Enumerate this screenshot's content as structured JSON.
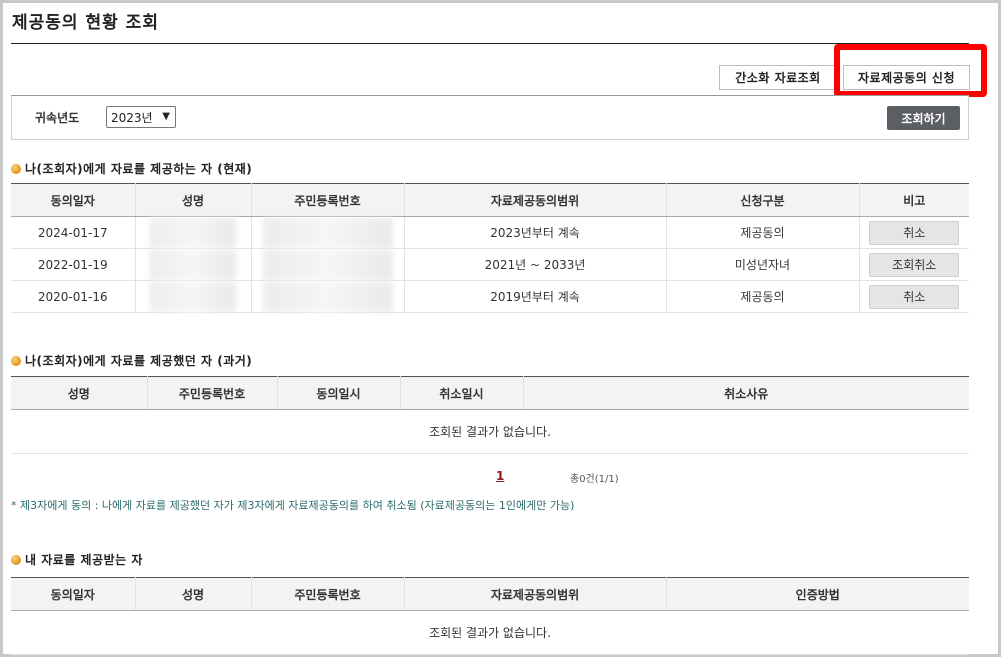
{
  "page": {
    "title": "제공동의 현황 조회"
  },
  "actions": {
    "simple_lookup": "간소화 자료조회",
    "consent_request": "자료제공동의 신청"
  },
  "search": {
    "label": "귀속년도",
    "year_value": "2023년",
    "submit_label": "조회하기"
  },
  "section_current": {
    "title": "나(조회자)에게 자료를 제공하는 자 (현재)",
    "headers": [
      "동의일자",
      "성명",
      "주민등록번호",
      "자료제공동의범위",
      "신청구분",
      "비고"
    ],
    "rows": [
      {
        "date": "2024-01-17",
        "name": "",
        "rrn": "",
        "scope": "2023년부터 계속",
        "type": "제공동의",
        "action": "취소"
      },
      {
        "date": "2022-01-19",
        "name": "",
        "rrn": "",
        "scope": "2021년 ~ 2033년",
        "type": "미성년자녀",
        "action": "조회취소"
      },
      {
        "date": "2020-01-16",
        "name": "",
        "rrn": "",
        "scope": "2019년부터 계속",
        "type": "제공동의",
        "action": "취소"
      }
    ]
  },
  "section_past": {
    "title": "나(조회자)에게 자료를 제공했던 자 (과거)",
    "headers": [
      "성명",
      "주민등록번호",
      "동의일시",
      "취소일시",
      "취소사유"
    ],
    "empty_text": "조회된 결과가 없습니다.",
    "pager": {
      "current": "1",
      "total": "총0건(1/1)"
    },
    "note": "* 제3자에게 동의 : 나에게 자료를 제공했던 자가 제3자에게 자료제공동의를 하여 취소됨 (자료제공동의는 1인에게만 가능)"
  },
  "section_recipients": {
    "title": "내 자료를 제공받는 자",
    "headers": [
      "동의일자",
      "성명",
      "주민등록번호",
      "자료제공동의범위",
      "인증방법"
    ],
    "empty_text": "조회된 결과가 없습니다."
  },
  "colors": {
    "highlight": "#ff0000",
    "dark_button": "#5b5e63",
    "pager_active": "#8b1a1a",
    "note": "#2a6b6a"
  }
}
